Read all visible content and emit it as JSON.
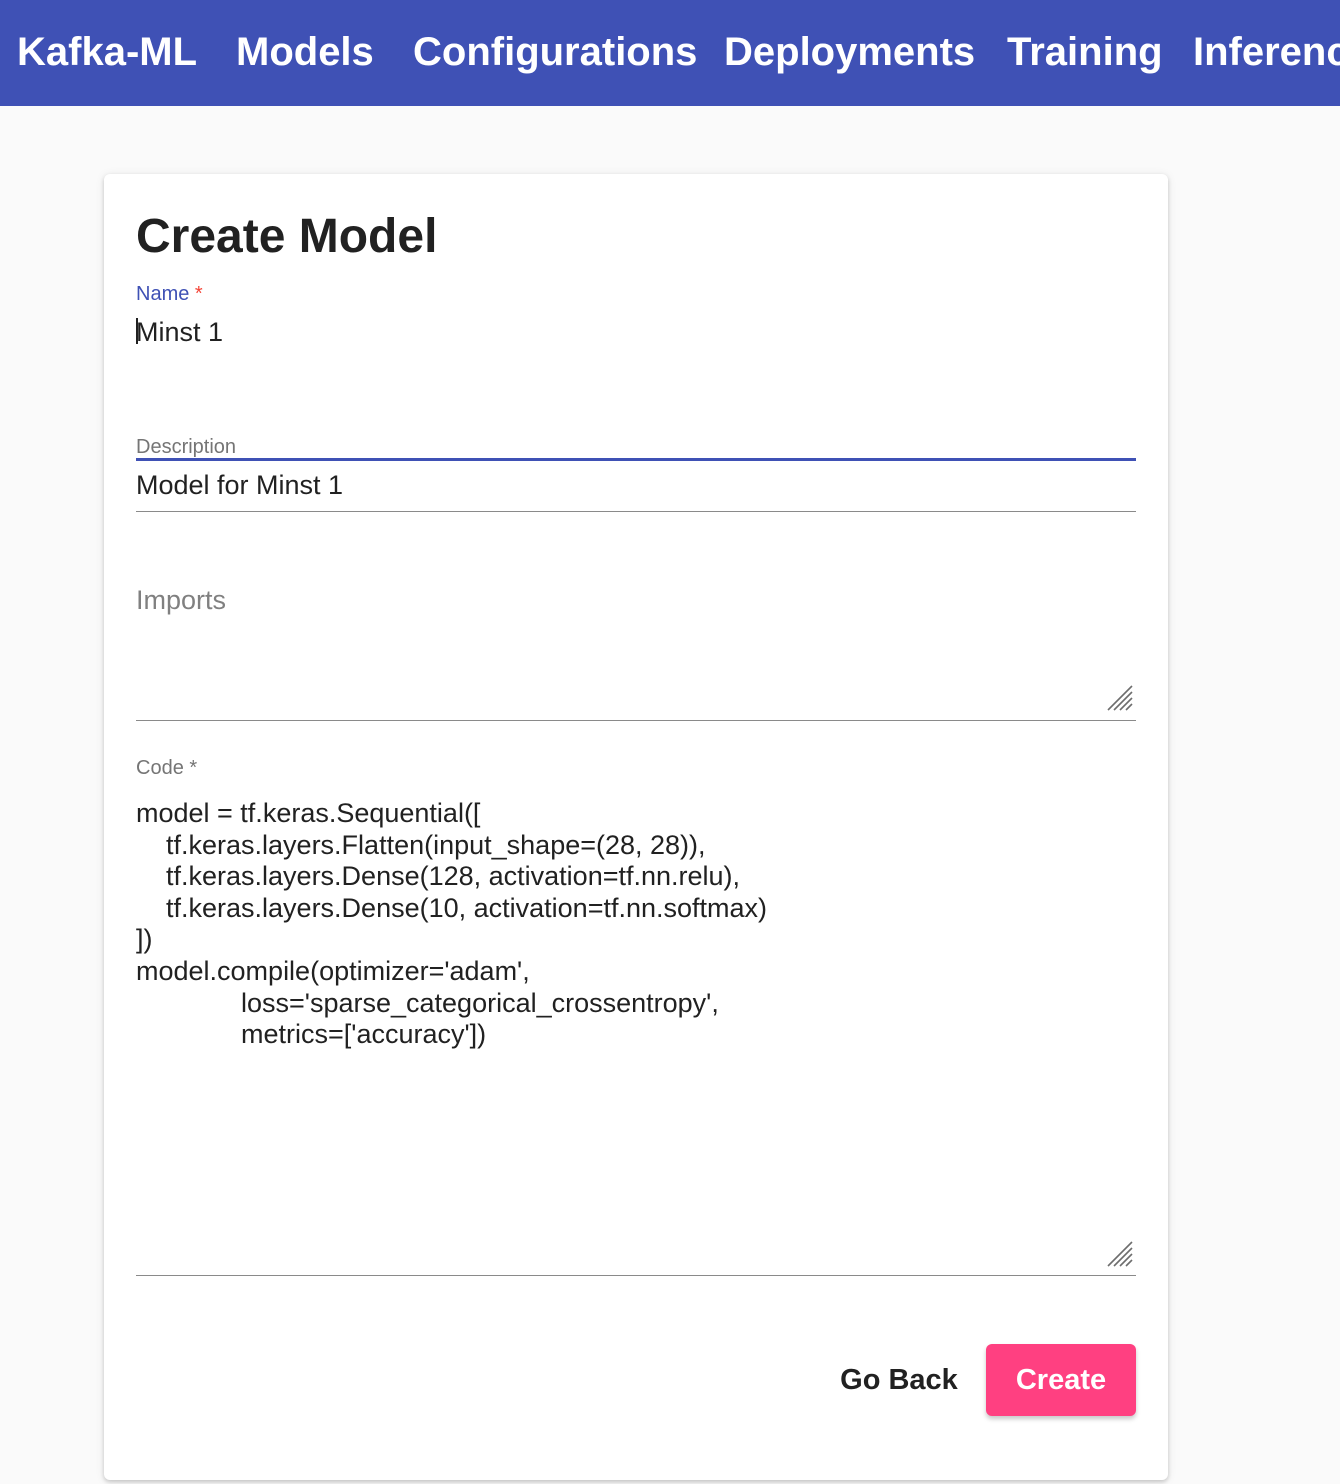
{
  "nav": {
    "brand": "Kafka-ML",
    "items": [
      "Models",
      "Configurations",
      "Deployments",
      "Training",
      "Inference"
    ]
  },
  "form": {
    "title": "Create Model",
    "name": {
      "label": "Name",
      "required_mark": "*",
      "value": "Minst 1"
    },
    "description": {
      "label": "Description",
      "value": "Model for Minst 1"
    },
    "imports": {
      "placeholder": "Imports",
      "value": ""
    },
    "code": {
      "label": "Code",
      "required_mark": "*",
      "value": "model = tf.keras.Sequential([\n    tf.keras.layers.Flatten(input_shape=(28, 28)),\n    tf.keras.layers.Dense(128, activation=tf.nn.relu),\n    tf.keras.layers.Dense(10, activation=tf.nn.softmax)\n])\nmodel.compile(optimizer='adam',\n              loss='sparse_categorical_crossentropy',\n              metrics=['accuracy'])"
    },
    "buttons": {
      "back": "Go Back",
      "create": "Create"
    }
  },
  "colors": {
    "primary": "#3f51b5",
    "accent": "#ff4081",
    "required": "#f44336",
    "background": "#fafafa"
  },
  "icons": {
    "resize_handle": "resize-handle-icon"
  }
}
